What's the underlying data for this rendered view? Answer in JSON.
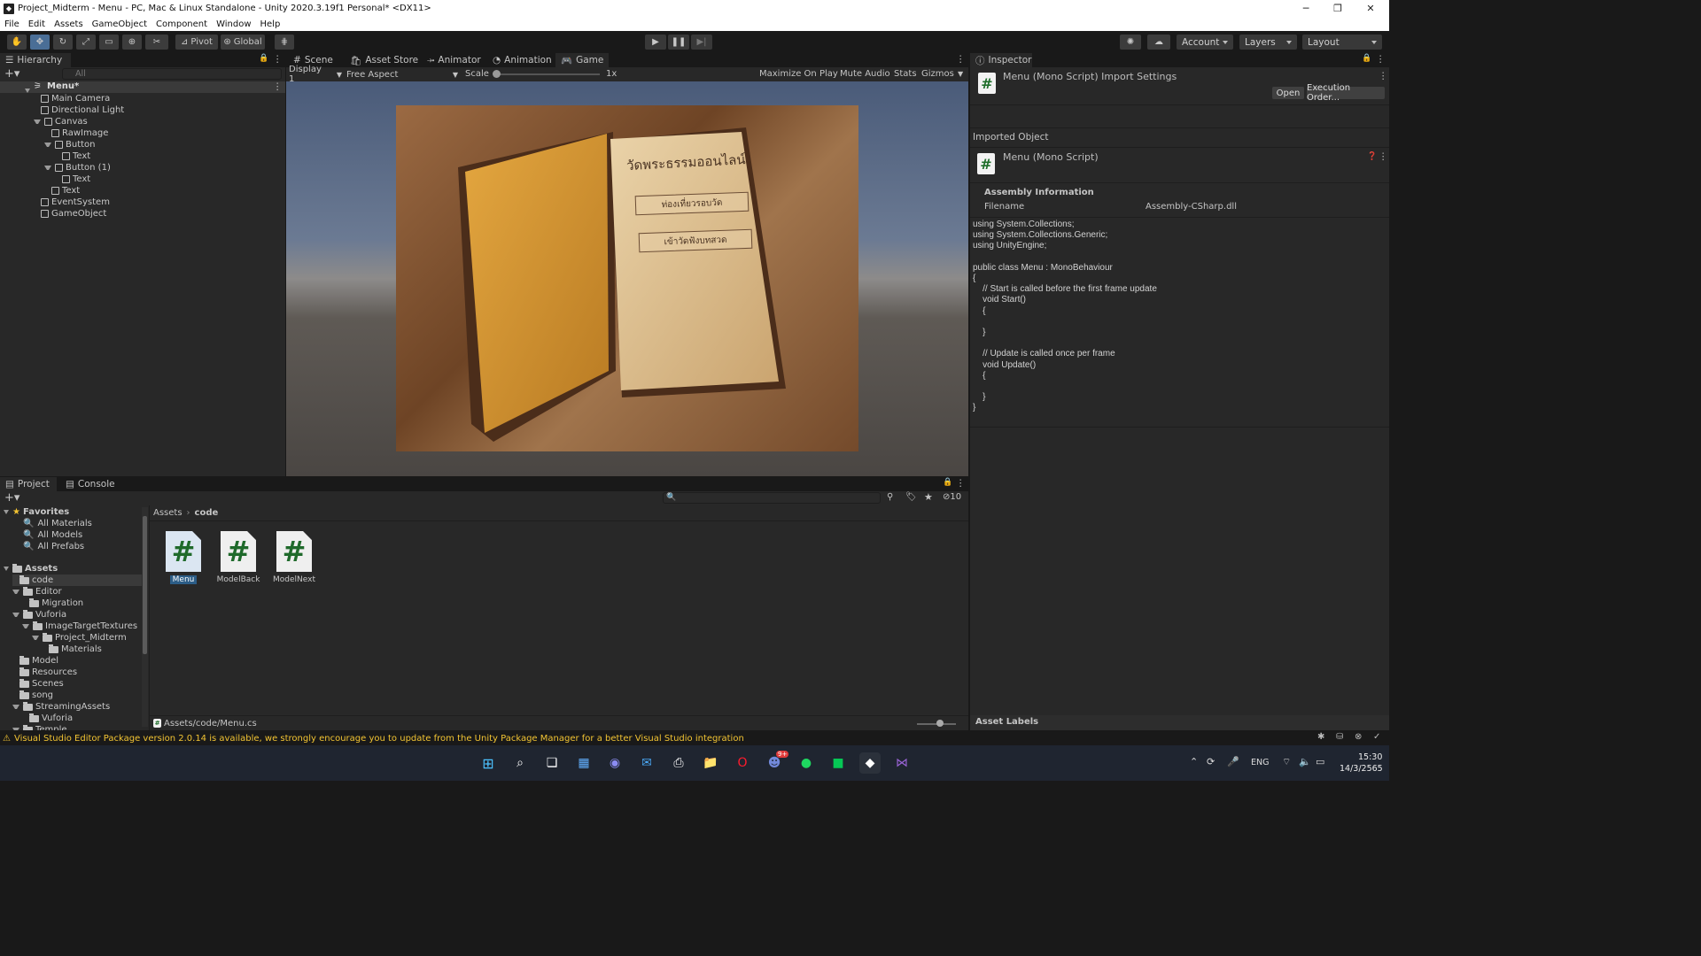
{
  "window": {
    "title": "Project_Midterm - Menu - PC, Mac & Linux Standalone - Unity 2020.3.19f1 Personal* <DX11>",
    "menu": [
      "File",
      "Edit",
      "Assets",
      "GameObject",
      "Component",
      "Window",
      "Help"
    ]
  },
  "toolbar": {
    "pivot": "Pivot",
    "global": "Global",
    "account": "Account",
    "layers": "Layers",
    "layout": "Layout"
  },
  "hierarchy": {
    "tab": "Hierarchy",
    "search_placeholder": "All",
    "scene": "Menu*",
    "items": [
      {
        "label": "Main Camera",
        "depth": 1,
        "expand": false
      },
      {
        "label": "Directional Light",
        "depth": 1,
        "expand": false
      },
      {
        "label": "Canvas",
        "depth": 1,
        "expand": true
      },
      {
        "label": "RawImage",
        "depth": 2,
        "expand": false
      },
      {
        "label": "Button",
        "depth": 2,
        "expand": true
      },
      {
        "label": "Text",
        "depth": 3,
        "expand": false
      },
      {
        "label": "Button (1)",
        "depth": 2,
        "expand": true
      },
      {
        "label": "Text",
        "depth": 3,
        "expand": false
      },
      {
        "label": "Text",
        "depth": 2,
        "expand": false
      },
      {
        "label": "EventSystem",
        "depth": 1,
        "expand": false
      },
      {
        "label": "GameObject",
        "depth": 1,
        "expand": false
      }
    ]
  },
  "center": {
    "tabs": [
      "Scene",
      "Asset Store",
      "Animator",
      "Animation",
      "Game"
    ],
    "active_tab": "Game",
    "display": "Display 1",
    "aspect": "Free Aspect",
    "scale_label": "Scale",
    "scale_value": "1x",
    "options": [
      "Maximize On Play",
      "Mute Audio",
      "Stats",
      "Gizmos"
    ]
  },
  "game_view": {
    "book_title": "วัดพระธรรมออนไลน์",
    "button1": "ท่องเที่ยวรอบวัด",
    "button2": "เข้าวัดฟังบทสวด"
  },
  "inspector": {
    "tab": "Inspector",
    "title": "Menu (Mono Script) Import Settings",
    "open": "Open",
    "execution_order": "Execution Order...",
    "imported_object": "Imported Object",
    "object_name": "Menu (Mono Script)",
    "assembly_info": "Assembly Information",
    "filename_label": "Filename",
    "filename_value": "Assembly-CSharp.dll",
    "code": "using System.Collections;\nusing System.Collections.Generic;\nusing UnityEngine;\n\npublic class Menu : MonoBehaviour\n{\n    // Start is called before the first frame update\n    void Start()\n    {\n\n    }\n\n    // Update is called once per frame\n    void Update()\n    {\n\n    }\n}",
    "asset_labels": "Asset Labels"
  },
  "project": {
    "tabs": [
      "Project",
      "Console"
    ],
    "favorites_label": "Favorites",
    "favorites": [
      "All Materials",
      "All Models",
      "All Prefabs"
    ],
    "assets_label": "Assets",
    "tree": [
      {
        "label": "code",
        "depth": 1,
        "expand": false,
        "selected": true
      },
      {
        "label": "Editor",
        "depth": 1,
        "expand": true
      },
      {
        "label": "Migration",
        "depth": 2,
        "expand": false
      },
      {
        "label": "Vuforia",
        "depth": 1,
        "expand": true
      },
      {
        "label": "ImageTargetTextures",
        "depth": 2,
        "expand": true
      },
      {
        "label": "Project_Midterm",
        "depth": 3,
        "expand": true
      },
      {
        "label": "Materials",
        "depth": 4,
        "expand": false
      },
      {
        "label": "Model",
        "depth": 1,
        "expand": false
      },
      {
        "label": "Resources",
        "depth": 1,
        "expand": false
      },
      {
        "label": "Scenes",
        "depth": 1,
        "expand": false
      },
      {
        "label": "song",
        "depth": 1,
        "expand": false
      },
      {
        "label": "StreamingAssets",
        "depth": 1,
        "expand": true
      },
      {
        "label": "Vuforia",
        "depth": 2,
        "expand": false
      },
      {
        "label": "Temple",
        "depth": 1,
        "expand": true
      }
    ],
    "breadcrumb": [
      "Assets",
      "code"
    ],
    "files": [
      "Menu",
      "ModelBack",
      "ModelNext"
    ],
    "selected_file": "Menu",
    "footer_path": "Assets/code/Menu.cs",
    "hidden_count": "10"
  },
  "status": {
    "warning": "Visual Studio Editor Package version 2.0.14 is available, we strongly encourage you to update from the Unity Package Manager for a better Visual Studio integration"
  },
  "taskbar": {
    "lang": "ENG",
    "time": "15:30",
    "date": "14/3/2565",
    "discord_badge": "9+"
  }
}
